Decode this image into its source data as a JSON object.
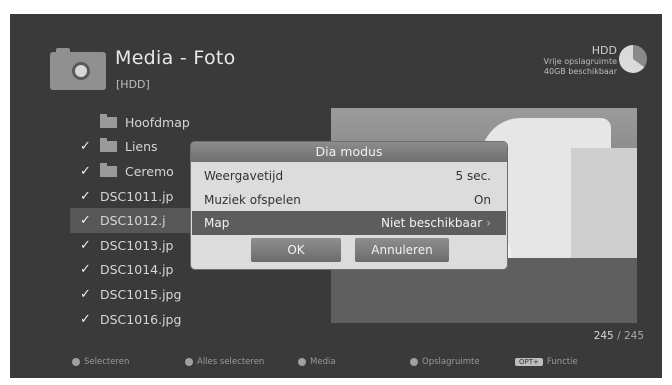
{
  "header": {
    "title": "Media - Foto",
    "subtitle": "[HDD]",
    "storage_name": "HDD",
    "storage_line1": "Vrije opslagruimte",
    "storage_line2": "40GB beschikbaar"
  },
  "file_list": [
    {
      "name": "Hoofdmap",
      "checked": false,
      "type": "folder",
      "selected": false
    },
    {
      "name": "Liens",
      "checked": true,
      "type": "folder",
      "selected": false
    },
    {
      "name": "Ceremo",
      "checked": true,
      "type": "folder",
      "selected": false
    },
    {
      "name": "DSC1011.jp",
      "checked": true,
      "type": "file",
      "selected": false
    },
    {
      "name": "DSC1012.j",
      "checked": true,
      "type": "file",
      "selected": true
    },
    {
      "name": "DSC1013.jp",
      "checked": true,
      "type": "file",
      "selected": false
    },
    {
      "name": "DSC1014.jp",
      "checked": true,
      "type": "file",
      "selected": false
    },
    {
      "name": "DSC1015.jpg",
      "checked": true,
      "type": "file",
      "selected": false
    },
    {
      "name": "DSC1016.jpg",
      "checked": true,
      "type": "file",
      "selected": false
    }
  ],
  "check_mark": "✓",
  "pagination": {
    "current": "245",
    "separator": " / ",
    "total": "245"
  },
  "dialog": {
    "title": "Dia modus",
    "rows": [
      {
        "label": "Weergavetijd",
        "value": "5 sec."
      },
      {
        "label": "Muziek ofspelen",
        "value": "On"
      },
      {
        "label": "Map",
        "value": "Niet beschikbaar"
      }
    ],
    "ok_label": "OK",
    "cancel_label": "Annuleren"
  },
  "footer": {
    "select": "Selecteren",
    "select_all": "Alles selecteren",
    "media": "Media",
    "storage": "Opslagruimte",
    "opt_badge": "OPT+",
    "function": "Functie"
  },
  "colors": {
    "background": "#3a3a3a",
    "dialog": "#dcdcdc",
    "highlight": "#5d5d5d"
  }
}
